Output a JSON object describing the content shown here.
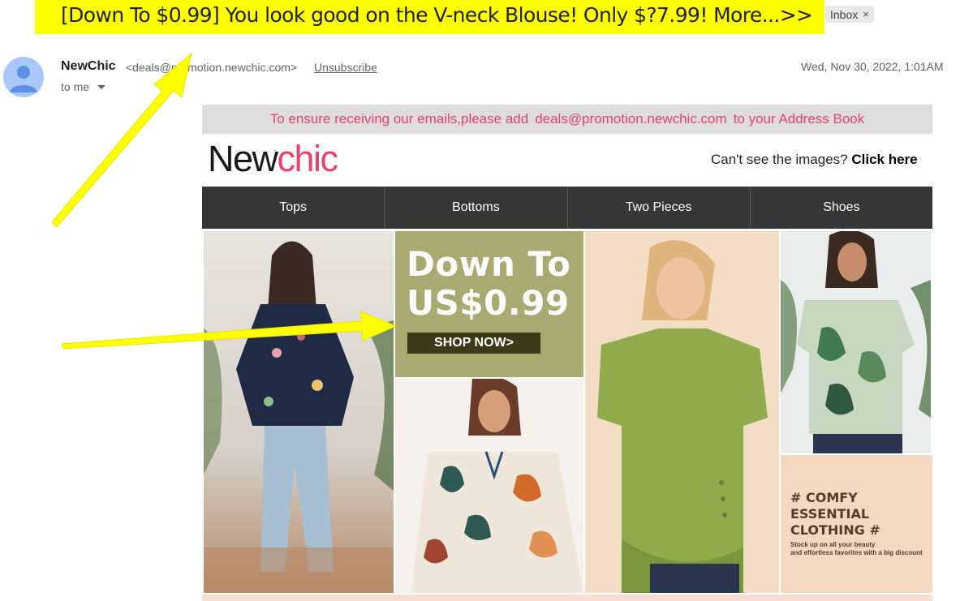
{
  "email": {
    "subject": "[Down To $0.99] You look good on the V-neck Blouse! Only $?7.99! More...>>",
    "label_chip": "Inbox",
    "label_chip_close": "×",
    "sender_name": "NewChic",
    "sender_email": "<deals@promotion.newchic.com>",
    "unsubscribe": "Unsubscribe",
    "date": "Wed, Nov 30, 2022, 1:01AM",
    "to": "to me"
  },
  "newsletter": {
    "address_bar": {
      "prefix": "To ensure receiving our emails,please add",
      "email": "deals@promotion.newchic.com",
      "suffix": "to your Address Book"
    },
    "logo": {
      "part1": "New",
      "part2": "chic"
    },
    "cant_see": {
      "text": "Can't see the images?",
      "link": "Click here"
    },
    "nav": [
      "Tops",
      "Bottoms",
      "Two Pieces",
      "Shoes"
    ],
    "promo": {
      "line1": "Down To",
      "line2": "US$0.99",
      "cta": "SHOP NOW>"
    },
    "comfy": {
      "line1": "# COMFY",
      "line2": "ESSENTIAL",
      "line3": "CLOTHING #",
      "sub1": "Stock up on all your beauty",
      "sub2": "and effortless favorites with a big discount"
    }
  },
  "colors": {
    "highlight": "#ffff00",
    "brand_pink": "#e8426b",
    "nav_bg": "#363636",
    "promo_bg": "#a9aa72"
  }
}
